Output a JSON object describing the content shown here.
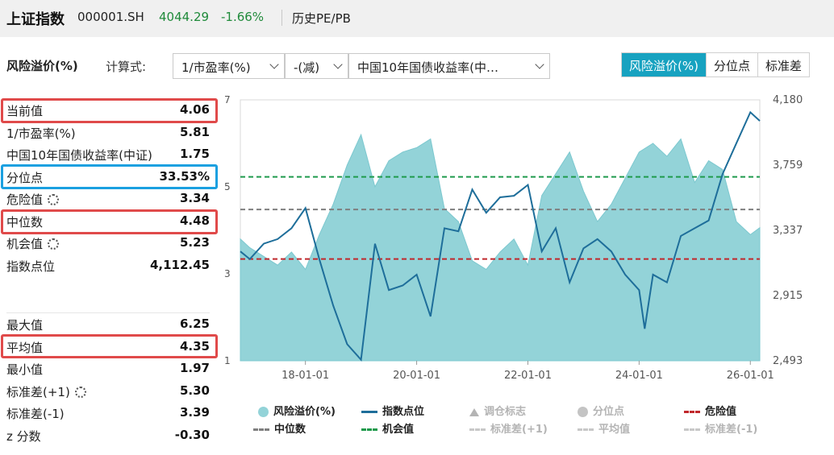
{
  "header": {
    "title": "上证指数",
    "code": "000001.SH",
    "price": "4044.29",
    "change": "-1.66%",
    "history_link": "历史PE/PB"
  },
  "controls": {
    "section_title": "风险溢价(%)",
    "formula_label": "计算式:",
    "select1": "1/市盈率(%)",
    "select2": "-(减)",
    "select3": "中国10年国债收益率(中…",
    "tabs": [
      "风险溢价(%)",
      "分位点",
      "标准差"
    ]
  },
  "stats": [
    {
      "label": "当前值",
      "value": "4.06"
    },
    {
      "label": "1/市盈率(%)",
      "value": "5.81"
    },
    {
      "label": "中国10年国债收益率(中证)",
      "value": "1.75"
    },
    {
      "label": "分位点",
      "value": "33.53%"
    },
    {
      "label": "危险值",
      "value": "3.34",
      "gear": true
    },
    {
      "label": "中位数",
      "value": "4.48"
    },
    {
      "label": "机会值",
      "value": "5.23",
      "gear": true
    },
    {
      "label": "指数点位",
      "value": "4,112.45"
    },
    {
      "label": "最大值",
      "value": "6.25"
    },
    {
      "label": "平均值",
      "value": "4.35"
    },
    {
      "label": "最小值",
      "value": "1.97"
    },
    {
      "label": "标准差(+1)",
      "value": "5.30",
      "gear": true
    },
    {
      "label": "标准差(-1)",
      "value": "3.39"
    },
    {
      "label": "z 分数",
      "value": "-0.30"
    }
  ],
  "colors": {
    "area_fill": "#93d3d8",
    "index_line": "#1e6e9a",
    "danger": "#c0282c",
    "median": "#7f7f7f",
    "opportunity": "#1f9a4c",
    "highlight_red": "#e04a4a",
    "highlight_blue": "#1aa0e0",
    "tab_active": "#17a2c0"
  },
  "chart_data": {
    "type": "area",
    "x_ticks": [
      "18-01-01",
      "20-01-01",
      "22-01-01",
      "24-01-01",
      "26-01-01"
    ],
    "left_axis": {
      "ticks": [
        "7",
        "5",
        "3",
        "1"
      ],
      "values": [
        7,
        5,
        3,
        1
      ],
      "range": [
        1,
        7
      ]
    },
    "right_axis": {
      "ticks": [
        "4,180",
        "3,759",
        "3,337",
        "2,915",
        "2,493"
      ],
      "values": [
        4180,
        3759,
        3337,
        2915,
        2493
      ],
      "range": [
        2493,
        4180
      ]
    },
    "reference_lines": {
      "opportunity": 5.23,
      "median": 4.48,
      "danger": 3.34
    },
    "series": [
      {
        "name": "风险溢价(%)",
        "axis": "left",
        "x": [
          2016.83,
          2017.0,
          2017.25,
          2017.5,
          2017.75,
          2018.0,
          2018.25,
          2018.5,
          2018.75,
          2019.0,
          2019.25,
          2019.5,
          2019.75,
          2020.0,
          2020.25,
          2020.5,
          2020.75,
          2021.0,
          2021.25,
          2021.5,
          2021.75,
          2022.0,
          2022.25,
          2022.5,
          2022.75,
          2023.0,
          2023.25,
          2023.5,
          2023.75,
          2024.0,
          2024.25,
          2024.5,
          2024.75,
          2025.0,
          2025.25,
          2025.5,
          2025.75,
          2026.0,
          2026.17
        ],
        "values": [
          3.8,
          3.6,
          3.4,
          3.2,
          3.5,
          3.1,
          3.9,
          4.6,
          5.5,
          6.2,
          5.0,
          5.6,
          5.8,
          5.9,
          6.1,
          4.5,
          4.2,
          3.3,
          3.1,
          3.5,
          3.8,
          3.2,
          4.8,
          5.3,
          5.8,
          4.9,
          4.2,
          4.6,
          5.2,
          5.8,
          6.0,
          5.7,
          6.1,
          5.1,
          5.6,
          5.4,
          4.2,
          3.9,
          4.06
        ]
      },
      {
        "name": "指数点位",
        "axis": "right",
        "x": [
          2016.83,
          2017.0,
          2017.25,
          2017.5,
          2017.75,
          2018.0,
          2018.25,
          2018.5,
          2018.75,
          2019.0,
          2019.25,
          2019.5,
          2019.75,
          2020.0,
          2020.25,
          2020.5,
          2020.75,
          2021.0,
          2021.25,
          2021.5,
          2021.75,
          2022.0,
          2022.25,
          2022.5,
          2022.75,
          2023.0,
          2023.25,
          2023.5,
          2023.75,
          2024.0,
          2024.1,
          2024.25,
          2024.5,
          2024.75,
          2025.0,
          2025.25,
          2025.5,
          2025.75,
          2026.0,
          2026.17
        ],
        "values": [
          3200,
          3150,
          3250,
          3280,
          3350,
          3480,
          3150,
          2850,
          2600,
          2500,
          3250,
          2950,
          2980,
          3050,
          2780,
          3350,
          3330,
          3600,
          3450,
          3550,
          3560,
          3630,
          3200,
          3350,
          3000,
          3220,
          3280,
          3200,
          3050,
          2950,
          2700,
          3050,
          3000,
          3300,
          3350,
          3400,
          3700,
          3900,
          4100,
          4044
        ]
      }
    ]
  },
  "legend": [
    {
      "label": "风险溢价(%)",
      "sym": "dot-teal",
      "active": true
    },
    {
      "label": "指数点位",
      "sym": "line-blue",
      "active": true
    },
    {
      "label": "调仓标志",
      "sym": "triangle",
      "active": false
    },
    {
      "label": "分位点",
      "sym": "dot-grey",
      "active": false
    },
    {
      "label": "危险值",
      "sym": "dash-red",
      "active": true
    },
    {
      "label": "中位数",
      "sym": "dash-grey",
      "active": true
    },
    {
      "label": "机会值",
      "sym": "dash-green",
      "active": true
    },
    {
      "label": "标准差(+1)",
      "sym": "dash-lightgrey",
      "active": false
    },
    {
      "label": "平均值",
      "sym": "dash-lightgrey",
      "active": false
    },
    {
      "label": "标准差(-1)",
      "sym": "dash-lightgrey",
      "active": false
    }
  ]
}
